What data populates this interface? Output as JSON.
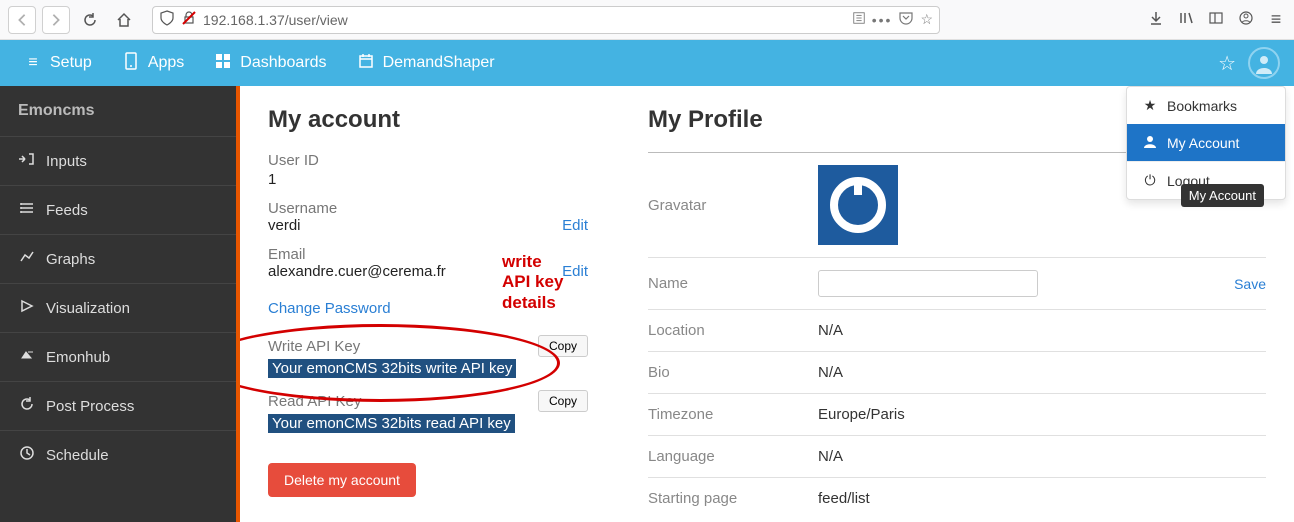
{
  "browser": {
    "url": "192.168.1.37/user/view"
  },
  "topnav": {
    "setup": "Setup",
    "apps": "Apps",
    "dashboards": "Dashboards",
    "demandshaper": "DemandShaper"
  },
  "dropdown": {
    "bookmarks": "Bookmarks",
    "my_account": "My Account",
    "logout": "Logout",
    "tooltip": "My Account"
  },
  "sidebar": {
    "title": "Emoncms",
    "items": [
      {
        "label": "Inputs",
        "icon": "inputs"
      },
      {
        "label": "Feeds",
        "icon": "feeds"
      },
      {
        "label": "Graphs",
        "icon": "graphs"
      },
      {
        "label": "Visualization",
        "icon": "viz"
      },
      {
        "label": "Emonhub",
        "icon": "emonhub"
      },
      {
        "label": "Post Process",
        "icon": "postprocess"
      },
      {
        "label": "Schedule",
        "icon": "schedule"
      }
    ]
  },
  "account": {
    "heading": "My account",
    "user_id_label": "User ID",
    "user_id": "1",
    "username_label": "Username",
    "username": "verdi",
    "username_edit": "Edit",
    "email_label": "Email",
    "email": "alexandre.cuer@cerema.fr",
    "email_edit": "Edit",
    "change_password": "Change Password",
    "write_api_label": "Write API Key",
    "write_api_value": "Your emonCMS 32bits write API key",
    "write_api_copy": "Copy",
    "read_api_label": "Read API Key",
    "read_api_value": "Your emonCMS 32bits read API key",
    "read_api_copy": "Copy",
    "delete": "Delete my account"
  },
  "profile": {
    "heading": "My Profile",
    "gravatar_label": "Gravatar",
    "name_label": "Name",
    "name_value": "",
    "name_save": "Save",
    "location_label": "Location",
    "location_value": "N/A",
    "bio_label": "Bio",
    "bio_value": "N/A",
    "timezone_label": "Timezone",
    "timezone_value": "Europe/Paris",
    "language_label": "Language",
    "language_value": "N/A",
    "startpage_label": "Starting page",
    "startpage_value": "feed/list"
  },
  "annotation": {
    "text": "write\nAPI key\ndetails"
  }
}
